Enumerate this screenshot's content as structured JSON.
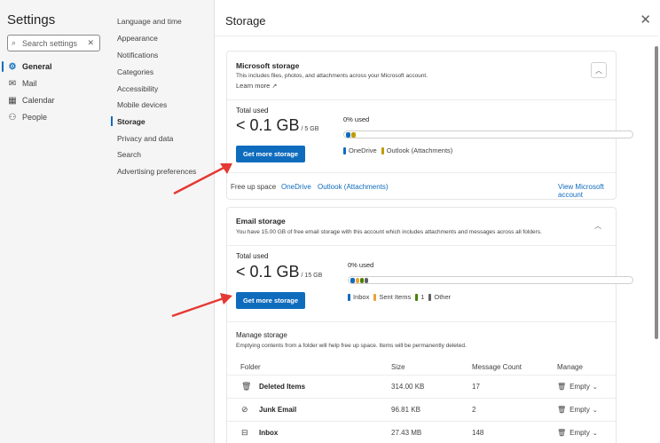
{
  "left_nav": {
    "title": "Settings",
    "search_placeholder": "Search settings",
    "items": [
      {
        "label": "General",
        "icon": "gear-icon",
        "active": true
      },
      {
        "label": "Mail",
        "icon": "mail-icon",
        "active": false
      },
      {
        "label": "Calendar",
        "icon": "calendar-icon",
        "active": false
      },
      {
        "label": "People",
        "icon": "people-icon",
        "active": false
      }
    ]
  },
  "sub_nav": {
    "items": [
      {
        "label": "Language and time"
      },
      {
        "label": "Appearance"
      },
      {
        "label": "Notifications"
      },
      {
        "label": "Categories"
      },
      {
        "label": "Accessibility"
      },
      {
        "label": "Mobile devices"
      },
      {
        "label": "Storage",
        "active": true
      },
      {
        "label": "Privacy and data"
      },
      {
        "label": "Search"
      },
      {
        "label": "Advertising preferences"
      }
    ]
  },
  "main": {
    "title": "Storage",
    "microsoft": {
      "title": "Microsoft storage",
      "desc": "This includes files, photos, and attachments across your Microsoft account.",
      "learn_more": "Learn more",
      "total_label": "Total used",
      "total_value": "< 0.1 GB",
      "total_of": "/ 5 GB",
      "pct": "0% used",
      "button": "Get more storage",
      "legend": [
        {
          "label": "OneDrive",
          "color": "#0f6cbd"
        },
        {
          "label": "Outlook (Attachments)",
          "color": "#c19c00"
        }
      ],
      "footer_label": "Free up space",
      "footer_links": [
        "OneDrive",
        "Outlook (Attachments)"
      ],
      "view_account": "View Microsoft account"
    },
    "email": {
      "title": "Email storage",
      "desc": "You have 15.00 GB of free email storage with this account which includes attachments and messages across all folders.",
      "total_label": "Total used",
      "total_value": "< 0.1 GB",
      "total_of": "/ 15 GB",
      "pct": "0% used",
      "button": "Get more storage",
      "legend": [
        {
          "label": "Inbox",
          "color": "#0f6cbd"
        },
        {
          "label": "Sent Items",
          "color": "#e8a33d"
        },
        {
          "label": "1",
          "color": "#498205"
        },
        {
          "label": "Other",
          "color": "#616161"
        }
      ],
      "manage_title": "Manage storage",
      "manage_desc": "Emptying contents from a folder will help free up space. Items will be permanently deleted.",
      "columns": [
        "Folder",
        "Size",
        "Message Count",
        "Manage"
      ],
      "rows": [
        {
          "icon": "trash-icon",
          "folder": "Deleted Items",
          "size": "314.00 KB",
          "count": "17",
          "action": "Empty"
        },
        {
          "icon": "junk-icon",
          "folder": "Junk Email",
          "size": "96.81 KB",
          "count": "2",
          "action": "Empty"
        },
        {
          "icon": "inbox-icon",
          "folder": "Inbox",
          "size": "27.43 MB",
          "count": "148",
          "action": "Empty"
        }
      ]
    }
  },
  "colors": {
    "accent": "#0f6cbd",
    "arrow": "#e53935"
  }
}
